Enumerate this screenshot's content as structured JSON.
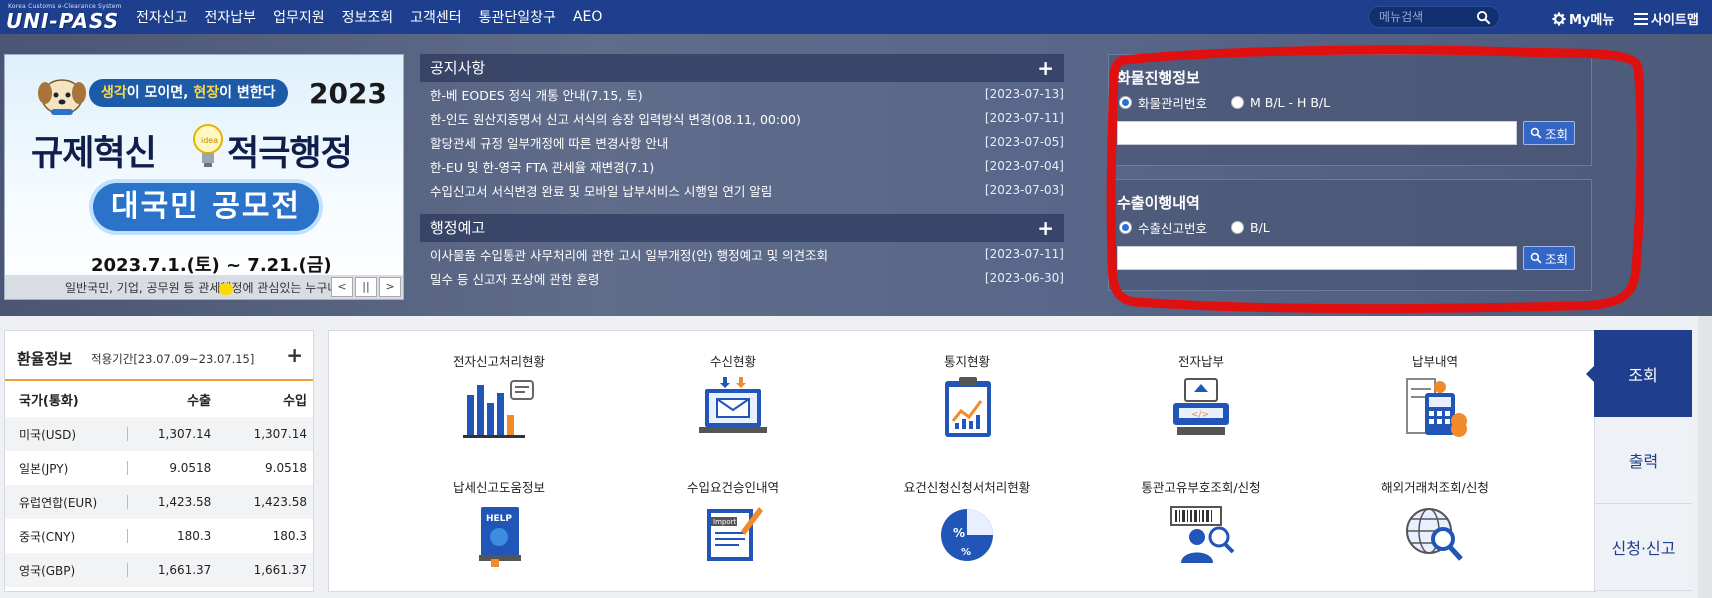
{
  "header": {
    "logo_tag": "Korea Customs e-Clearance System",
    "logo_text": "UNI-PASS",
    "nav": [
      "전자신고",
      "전자납부",
      "업무지원",
      "정보조회",
      "고객센터",
      "통관단일창구",
      "AEO"
    ],
    "search_placeholder": "메뉴검색",
    "mymenu_label": "My메뉴",
    "sitemap_label": "사이트맵"
  },
  "banner": {
    "pill_pre": "생각",
    "pill_mid": "이 모이면, ",
    "pill_hl": "현장",
    "pill_post": "이 변한다",
    "year": "2023",
    "headline_left": "규제혁신",
    "headline_right": "적극행정",
    "contest": "대국민 공모전",
    "dates": "2023.7.1.(토) ~ 7.21.(금)",
    "sub": "일반국민, 기업, 공무원 등 관세행정에 관심있는 누구나",
    "controls": [
      "<",
      "||",
      ">"
    ]
  },
  "notices": {
    "title": "공지사항",
    "items": [
      {
        "title": "한-베 EODES 정식 개통 안내(7.15, 토)",
        "date": "[2023-07-13]"
      },
      {
        "title": "한-인도 원산지증명서 신고 서식의 송장 입력방식 변경(08.11, 00:00)",
        "date": "[2023-07-11]"
      },
      {
        "title": "할당관세 규정 일부개정에 따른 변경사항 안내",
        "date": "[2023-07-05]"
      },
      {
        "title": "한-EU 및 한-영국 FTA 관세율 재변경(7.1)",
        "date": "[2023-07-04]"
      },
      {
        "title": "수입신고서 서식변경 완료 및 모바일 납부서비스 시행일 연기 알림",
        "date": "[2023-07-03]"
      }
    ]
  },
  "admin_notice": {
    "title": "행정예고",
    "items": [
      {
        "title": "이사물품 수입통관 사무처리에 관한 고시 일부개정(안) 행정예고 및 의견조회",
        "date": "[2023-07-11]"
      },
      {
        "title": "밀수 등 신고자 포상에 관한 훈령",
        "date": "[2023-06-30]"
      }
    ]
  },
  "cargo_search": {
    "title": "화물진행정보",
    "radio1": "화물관리번호",
    "radio2": "M B/L - H B/L",
    "button": "조회"
  },
  "export_search": {
    "title": "수출이행내역",
    "radio1": "수출신고번호",
    "radio2": "B/L",
    "button": "조회"
  },
  "fx": {
    "title": "환율정보",
    "period": "적용기간[23.07.09~23.07.15]",
    "headers": [
      "국가(통화)",
      "수출",
      "수입"
    ],
    "rows": [
      {
        "country": "미국(USD)",
        "export": "1,307.14",
        "import": "1,307.14"
      },
      {
        "country": "일본(JPY)",
        "export": "9.0518",
        "import": "9.0518"
      },
      {
        "country": "유럽연합(EUR)",
        "export": "1,423.58",
        "import": "1,423.58"
      },
      {
        "country": "중국(CNY)",
        "export": "180.3",
        "import": "180.3"
      },
      {
        "country": "영국(GBP)",
        "export": "1,661.37",
        "import": "1,661.37"
      }
    ]
  },
  "services": [
    {
      "l1": "전자신고",
      "l2": "처리현황",
      "icon": "bar-chart-icon"
    },
    {
      "l1": "",
      "l2": "수신현황",
      "icon": "monitor-mail-icon"
    },
    {
      "l1": "",
      "l2": "통지현황",
      "icon": "clipboard-chart-icon"
    },
    {
      "l1": "",
      "l2": "전자납부",
      "icon": "payment-terminal-icon"
    },
    {
      "l1": "",
      "l2": "납부내역",
      "icon": "calculator-receipt-icon"
    },
    {
      "l1": "납세신고",
      "l2": "도움정보",
      "icon": "help-book-icon"
    },
    {
      "l1": "수입요건",
      "l2": "승인내역",
      "icon": "import-document-icon"
    },
    {
      "l1": "요건신청신청서",
      "l2": "처리현황",
      "icon": "percent-pie-icon"
    },
    {
      "l1": "통관고유부호",
      "l2": "조회/신청",
      "icon": "barcode-person-icon"
    },
    {
      "l1": "해외거래처",
      "l2": "조회/신청",
      "icon": "globe-search-icon"
    }
  ],
  "side_tabs": [
    "조회",
    "출력",
    "신청·신고"
  ],
  "colors": {
    "nav_bg": "#1e3f8e",
    "accent_red": "#e01010",
    "button_blue": "#3466c7",
    "fx_accent": "#f29a3c"
  }
}
